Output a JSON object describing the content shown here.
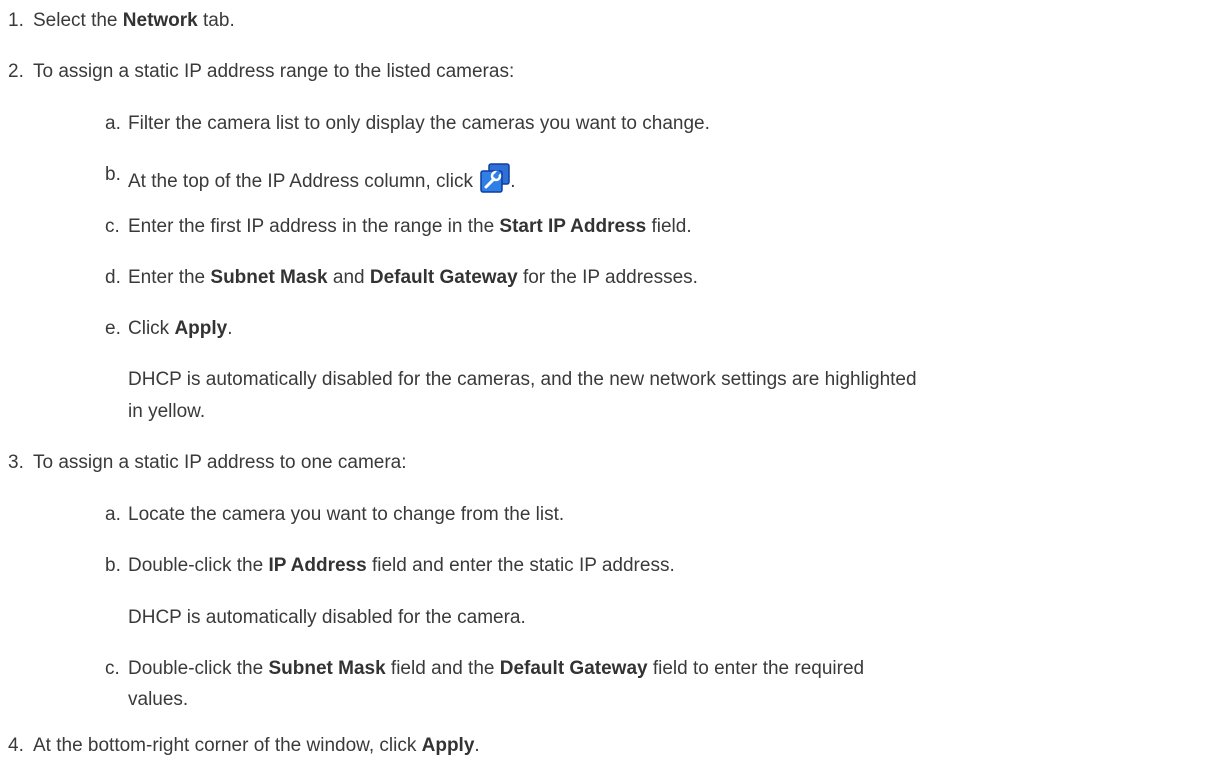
{
  "steps": {
    "s1": {
      "num": "1.",
      "pre": "Select the ",
      "b1": "Network",
      "post": " tab."
    },
    "s2": {
      "num": "2.",
      "text": "To assign a static IP address range to the listed cameras:",
      "a": {
        "num": "a.",
        "text": "Filter the camera list to only display the cameras you want to change."
      },
      "b": {
        "num": "b.",
        "pre": "At the top of the IP Address column, click ",
        "post": ".",
        "icon": "wrench-settings-icon"
      },
      "c": {
        "num": "c.",
        "pre": "Enter the first IP address in the range in the ",
        "b1": "Start IP Address",
        "post": " field."
      },
      "d": {
        "num": "d.",
        "pre": "Enter the ",
        "b1": "Subnet Mask",
        "mid": " and ",
        "b2": "Default Gateway",
        "post": " for the IP addresses."
      },
      "e": {
        "num": "e.",
        "pre": "Click ",
        "b1": "Apply",
        "post": "."
      },
      "note_line1": "DHCP is automatically disabled for the cameras, and the new network settings are highlighted",
      "note_line2": "in yellow."
    },
    "s3": {
      "num": "3.",
      "text": "To assign a static IP address to one camera:",
      "a": {
        "num": "a.",
        "text": "Locate the camera you want to change from the list."
      },
      "b": {
        "num": "b.",
        "pre": "Double-click the ",
        "b1": "IP Address",
        "post": " field and enter the static IP address."
      },
      "note": "DHCP is automatically disabled for the camera.",
      "c": {
        "num": "c.",
        "pre": "Double-click the ",
        "b1": "Subnet Mask",
        "mid": " field and the ",
        "b2": "Default Gateway",
        "post": " field to enter the required",
        "line2": "values."
      }
    },
    "s4": {
      "num": "4.",
      "pre": "At the bottom-right corner of the window, click ",
      "b1": "Apply",
      "post": "."
    }
  }
}
